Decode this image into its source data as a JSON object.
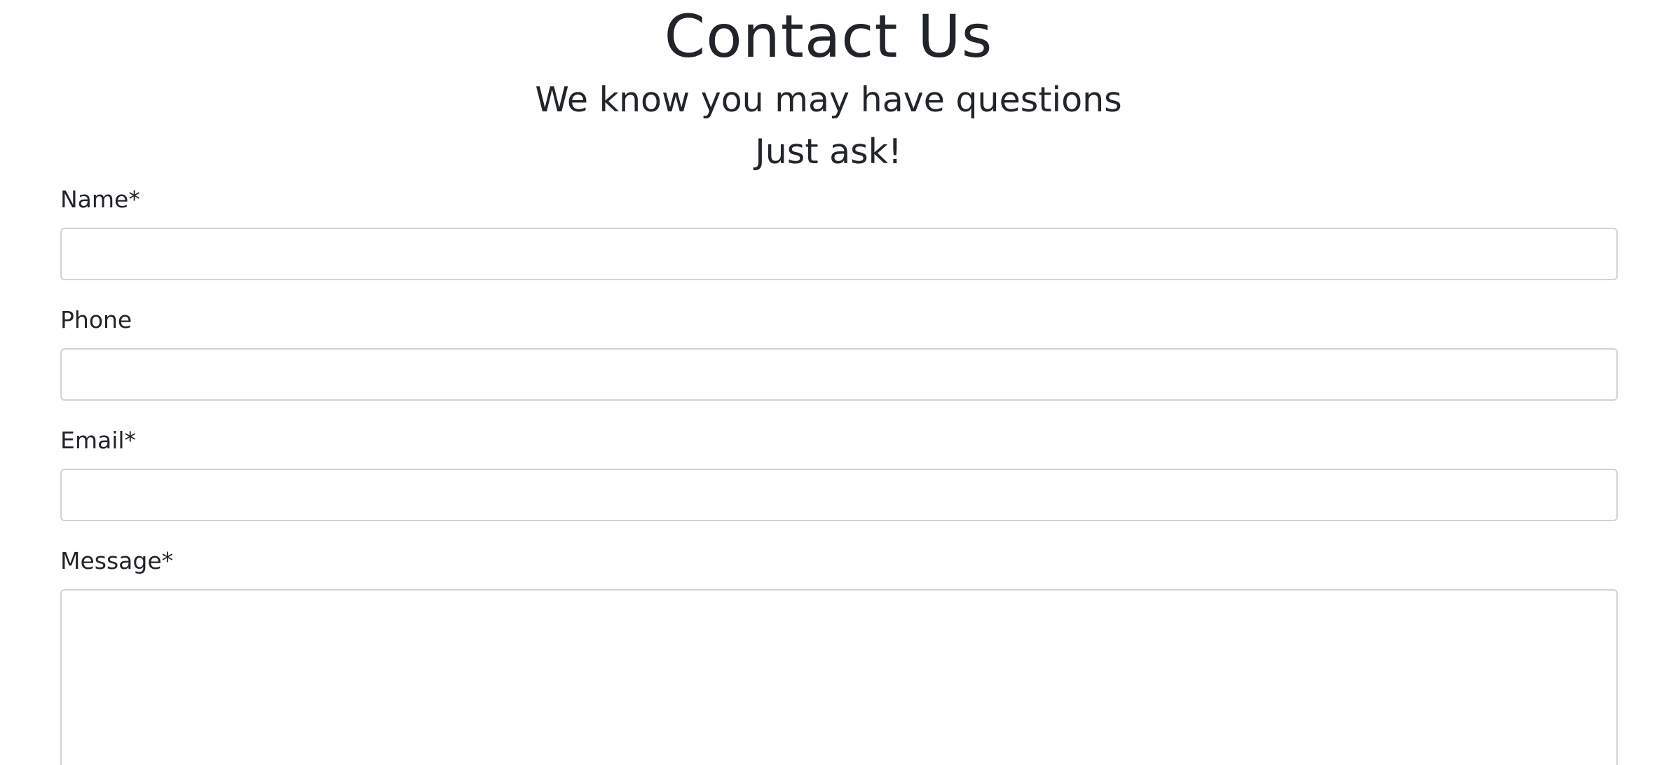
{
  "header": {
    "title": "Contact Us",
    "subtitle_line1": "We know you may have questions",
    "subtitle_line2": "Just ask!"
  },
  "form": {
    "name": {
      "label": "Name*",
      "value": "",
      "placeholder": ""
    },
    "phone": {
      "label": "Phone",
      "value": "",
      "placeholder": ""
    },
    "email": {
      "label": "Email*",
      "value": "",
      "placeholder": ""
    },
    "message": {
      "label": "Message*",
      "value": "",
      "placeholder": ""
    }
  },
  "colors": {
    "text": "#212529",
    "input_border": "#ced4da",
    "background": "#ffffff"
  }
}
